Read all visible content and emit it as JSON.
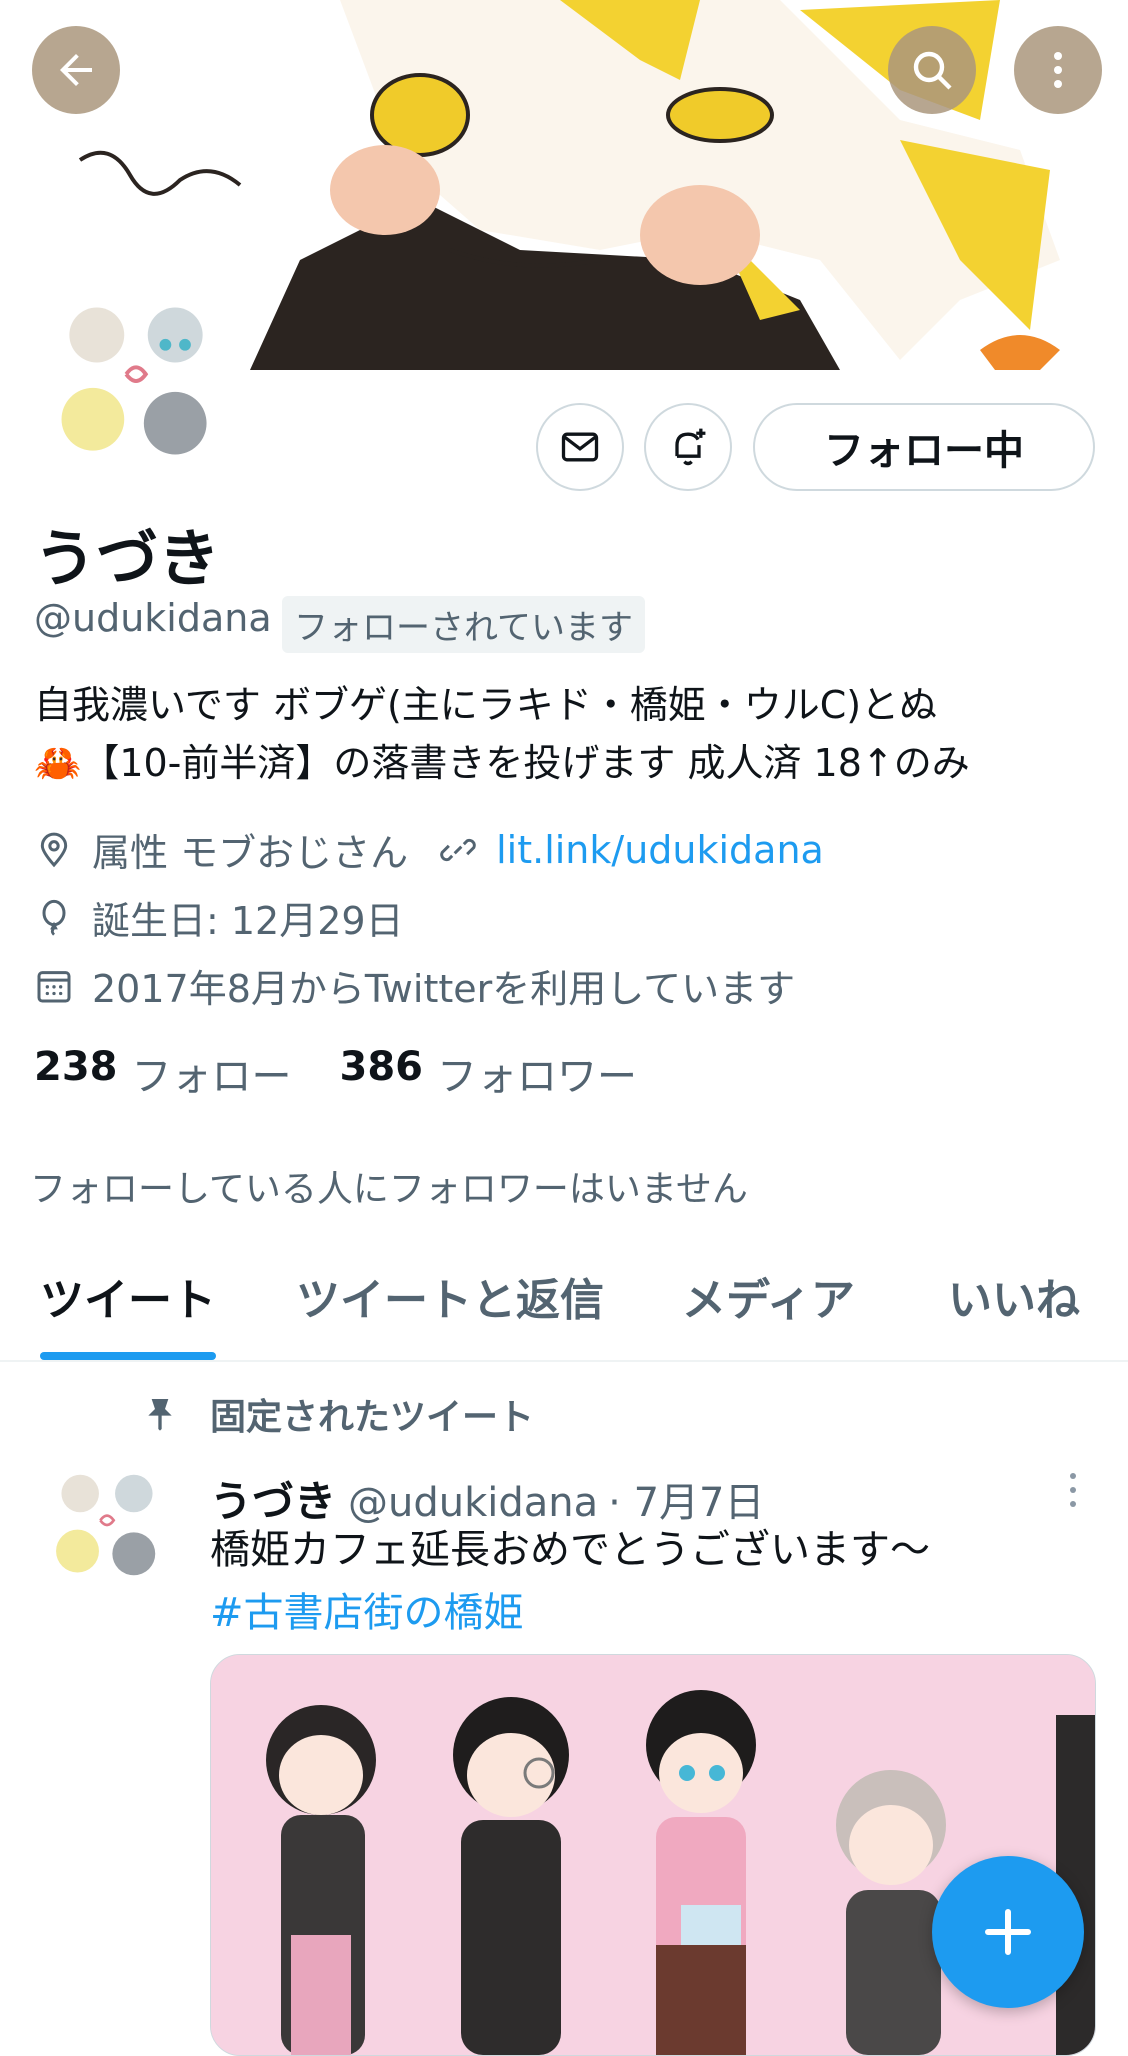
{
  "profile": {
    "name": "うづき",
    "handle": "@udukidana",
    "follows_you": "フォローされています",
    "bio_line1": "自我濃いです ボブゲ(主にラキド・橋姫・ウルC)とぬ",
    "bio_line2": "🦀【10-前半済】の落書きを投げます 成人済 18↑のみ",
    "location": "属性 モブおじさん",
    "link": "lit.link/udukidana",
    "birthday": "誕生日: 12月29日",
    "joined": "2017年8月からTwitterを利用しています",
    "following_count": "238",
    "following_label": "フォロー",
    "followers_count": "386",
    "followers_label": "フォロワー",
    "no_mutual_followers": "フォローしている人にフォロワーはいません"
  },
  "actions": {
    "follow_button": "フォロー中",
    "message_icon": "envelope-icon",
    "notify_icon": "bell-plus-icon"
  },
  "tabs": [
    {
      "label": "ツイート",
      "active": true
    },
    {
      "label": "ツイートと返信",
      "active": false
    },
    {
      "label": "メディア",
      "active": false
    },
    {
      "label": "いいね",
      "active": false
    }
  ],
  "pinned_tweet": {
    "pinned_label": "固定されたツイート",
    "author": "うづき",
    "handle": "@udukidana",
    "date": "· 7月7日",
    "text": "橋姫カフェ延長おめでとうございます〜",
    "hashtag": "#古書店街の橋姫"
  },
  "colors": {
    "accent": "#1d9bf0",
    "secondary_text": "#536471",
    "overlay_button": "#aa967d"
  }
}
